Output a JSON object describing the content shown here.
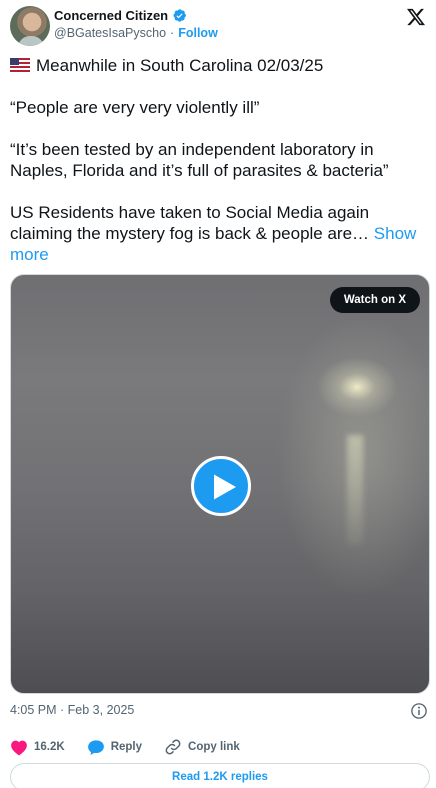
{
  "author": {
    "name": "Concerned Citizen",
    "handle": "@BGatesIsaPyscho",
    "separator": "·",
    "follow_label": "Follow"
  },
  "tweet": {
    "line1": "Meanwhile in South Carolina 02/03/25",
    "line2": "“People are very very violently ill”",
    "line3": "“It’s been tested by an independent laboratory in Naples, Florida and it’s full of parasites & bacteria”",
    "line4": "US Residents have taken to Social Media again claiming the mystery fog is back & people are…",
    "show_more": "Show more"
  },
  "video": {
    "watch_label": "Watch on X"
  },
  "meta": {
    "timestamp": "4:05 PM · Feb 3, 2025"
  },
  "actions": {
    "likes": "16.2K",
    "reply_label": "Reply",
    "copy_link_label": "Copy link"
  },
  "footer": {
    "read_replies": "Read 1.2K replies"
  },
  "colors": {
    "accent": "#1d9bf0",
    "like": "#f91880",
    "text": "#0f1419",
    "muted": "#536471"
  }
}
